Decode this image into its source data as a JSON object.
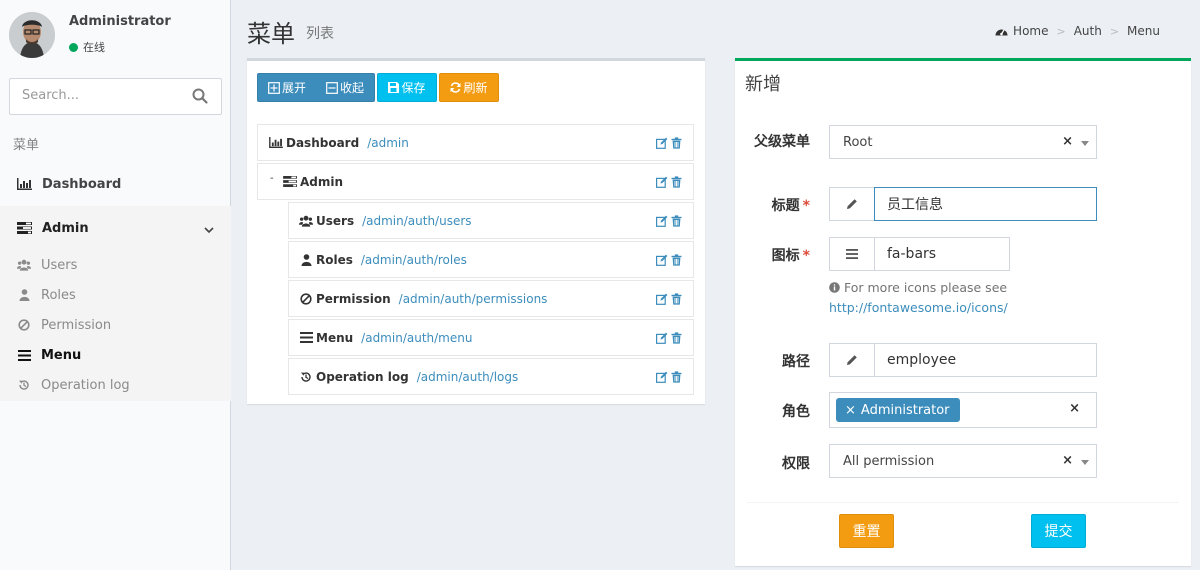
{
  "user": {
    "name": "Administrator",
    "status": "在线"
  },
  "sidebar": {
    "search_placeholder": "Search...",
    "header": "菜单",
    "items": [
      {
        "label": "Dashboard",
        "icon": "bar-chart-icon"
      },
      {
        "label": "Admin",
        "icon": "tasks-icon",
        "expanded": true
      }
    ],
    "subitems": [
      {
        "label": "Users",
        "icon": "users-icon"
      },
      {
        "label": "Roles",
        "icon": "user-icon"
      },
      {
        "label": "Permission",
        "icon": "ban-icon"
      },
      {
        "label": "Menu",
        "icon": "bars-icon",
        "active": true
      },
      {
        "label": "Operation log",
        "icon": "history-icon"
      }
    ]
  },
  "header": {
    "title": "菜单",
    "subtitle": "列表",
    "breadcrumb": [
      "Home",
      "Auth",
      "Menu"
    ]
  },
  "toolbar": {
    "expand": "展开",
    "collapse": "收起",
    "save": "保存",
    "refresh": "刷新"
  },
  "tree": [
    {
      "label": "Dashboard",
      "path": "/admin",
      "icon": "bar-chart-icon",
      "level": 0
    },
    {
      "label": "Admin",
      "path": "",
      "icon": "tasks-icon",
      "level": 0
    },
    {
      "label": "Users",
      "path": "/admin/auth/users",
      "icon": "users-icon",
      "level": 1
    },
    {
      "label": "Roles",
      "path": "/admin/auth/roles",
      "icon": "user-icon",
      "level": 1
    },
    {
      "label": "Permission",
      "path": "/admin/auth/permissions",
      "icon": "ban-icon",
      "level": 1
    },
    {
      "label": "Menu",
      "path": "/admin/auth/menu",
      "icon": "bars-icon",
      "level": 1
    },
    {
      "label": "Operation log",
      "path": "/admin/auth/logs",
      "icon": "history-icon",
      "level": 1
    }
  ],
  "form": {
    "title": "新增",
    "parent": {
      "label": "父级菜单",
      "value": "Root"
    },
    "title_field": {
      "label": "标题",
      "value": "员工信息"
    },
    "icon_field": {
      "label": "图标",
      "value": "fa-bars"
    },
    "help_text": "For more icons please see",
    "help_link": "http://fontawesome.io/icons/",
    "uri": {
      "label": "路径",
      "value": "employee"
    },
    "roles": {
      "label": "角色",
      "tag": "Administrator"
    },
    "permission": {
      "label": "权限",
      "value": "All permission"
    },
    "reset": "重置",
    "submit": "提交"
  },
  "colors": {
    "primary": "#3c8dbc",
    "info": "#00c0ef",
    "warning": "#f39c12",
    "success": "#00a65a",
    "danger": "#dd4b39"
  }
}
